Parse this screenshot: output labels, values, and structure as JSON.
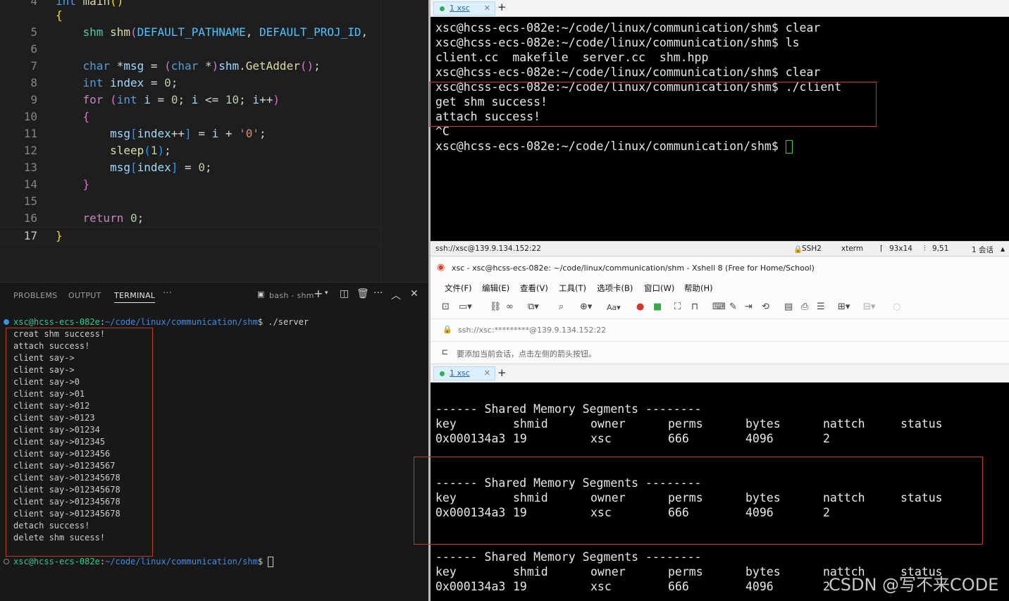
{
  "editor": {
    "lines": [
      {
        "num": "4",
        "parts": [
          [
            "k",
            "int"
          ],
          [
            "p",
            " "
          ],
          [
            "f",
            "main"
          ],
          [
            "b",
            "()"
          ]
        ]
      },
      {
        "num": "5",
        "parts": [
          [
            "b",
            "{"
          ]
        ]
      },
      {
        "num": "5",
        "parts": [
          [
            "p",
            "    "
          ],
          [
            "t",
            "shm"
          ],
          [
            "p",
            " "
          ],
          [
            "f",
            "shm"
          ],
          [
            "b2",
            "("
          ],
          [
            "c",
            "DEFAULT_PATHNAME"
          ],
          [
            "p",
            ", "
          ],
          [
            "c",
            "DEFAULT_PROJ_ID"
          ],
          [
            "p",
            ","
          ]
        ]
      },
      {
        "num": "6",
        "parts": []
      },
      {
        "num": "7",
        "parts": [
          [
            "p",
            "    "
          ],
          [
            "k",
            "char"
          ],
          [
            "p",
            " *"
          ],
          [
            "v",
            "msg"
          ],
          [
            "p",
            " = "
          ],
          [
            "b2",
            "("
          ],
          [
            "k",
            "char"
          ],
          [
            "p",
            " *"
          ],
          [
            "b2",
            ")"
          ],
          [
            "v",
            "shm"
          ],
          [
            "p",
            "."
          ],
          [
            "f",
            "GetAdder"
          ],
          [
            "b2",
            "()"
          ],
          [
            "p",
            ";"
          ]
        ]
      },
      {
        "num": "8",
        "parts": [
          [
            "p",
            "    "
          ],
          [
            "k",
            "int"
          ],
          [
            "p",
            " "
          ],
          [
            "v",
            "index"
          ],
          [
            "p",
            " = "
          ],
          [
            "n",
            "0"
          ],
          [
            "p",
            ";"
          ]
        ]
      },
      {
        "num": "9",
        "parts": [
          [
            "p",
            "    "
          ],
          [
            "m",
            "for"
          ],
          [
            "p",
            " "
          ],
          [
            "b2",
            "("
          ],
          [
            "k",
            "int"
          ],
          [
            "p",
            " "
          ],
          [
            "v",
            "i"
          ],
          [
            "p",
            " = "
          ],
          [
            "n",
            "0"
          ],
          [
            "p",
            "; "
          ],
          [
            "v",
            "i"
          ],
          [
            "p",
            " <= "
          ],
          [
            "n",
            "10"
          ],
          [
            "p",
            "; "
          ],
          [
            "v",
            "i"
          ],
          [
            "p",
            "++"
          ],
          [
            "b2",
            ")"
          ]
        ]
      },
      {
        "num": "10",
        "parts": [
          [
            "p",
            "    "
          ],
          [
            "b2",
            "{"
          ]
        ]
      },
      {
        "num": "11",
        "parts": [
          [
            "p",
            "        "
          ],
          [
            "v",
            "msg"
          ],
          [
            "b3",
            "["
          ],
          [
            "v",
            "index"
          ],
          [
            "p",
            "++"
          ],
          [
            "b3",
            "]"
          ],
          [
            "p",
            " = "
          ],
          [
            "v",
            "i"
          ],
          [
            "p",
            " + "
          ],
          [
            "s",
            "'0'"
          ],
          [
            "p",
            ";"
          ]
        ]
      },
      {
        "num": "12",
        "parts": [
          [
            "p",
            "        "
          ],
          [
            "f",
            "sleep"
          ],
          [
            "b3",
            "("
          ],
          [
            "n",
            "1"
          ],
          [
            "b3",
            ")"
          ],
          [
            "p",
            ";"
          ]
        ]
      },
      {
        "num": "13",
        "parts": [
          [
            "p",
            "        "
          ],
          [
            "v",
            "msg"
          ],
          [
            "b3",
            "["
          ],
          [
            "v",
            "index"
          ],
          [
            "b3",
            "]"
          ],
          [
            "p",
            " = "
          ],
          [
            "n",
            "0"
          ],
          [
            "p",
            ";"
          ]
        ]
      },
      {
        "num": "14",
        "parts": [
          [
            "p",
            "    "
          ],
          [
            "b2",
            "}"
          ]
        ]
      },
      {
        "num": "15",
        "parts": []
      },
      {
        "num": "16",
        "parts": [
          [
            "p",
            "    "
          ],
          [
            "m",
            "return"
          ],
          [
            "p",
            " "
          ],
          [
            "n",
            "0"
          ],
          [
            "p",
            ";"
          ]
        ]
      },
      {
        "num": "17",
        "parts": [
          [
            "b",
            "}"
          ]
        ]
      }
    ]
  },
  "panel": {
    "tabs": [
      "PROBLEMS",
      "OUTPUT",
      "TERMINAL"
    ],
    "more": "···",
    "terminal_name": "bash - shm",
    "prompt_user": "xsc@hcss-ecs-082e",
    "prompt_path": "~/code/linux/communication/shm",
    "command": "./server",
    "output": [
      "creat shm success!",
      "attach success!",
      "client say->",
      "client say->",
      "client say->0",
      "client say->01",
      "client say->012",
      "client say->0123",
      "client say->01234",
      "client say->012345",
      "client say->0123456",
      "client say->01234567",
      "client say->012345678",
      "client say->012345678",
      "client say->012345678",
      "client say->012345678",
      "detach success!",
      "delete shm sucess!"
    ]
  },
  "xshell_top": {
    "tab_label": "1 xsc",
    "lines": [
      "xsc@hcss-ecs-082e:~/code/linux/communication/shm$ clear",
      "xsc@hcss-ecs-082e:~/code/linux/communication/shm$ ls",
      "client.cc  makefile  server.cc  shm.hpp",
      "xsc@hcss-ecs-082e:~/code/linux/communication/shm$ clear",
      "xsc@hcss-ecs-082e:~/code/linux/communication/shm$ ./client",
      "get shm success!",
      "attach success!",
      "^C",
      "xsc@hcss-ecs-082e:~/code/linux/communication/shm$ "
    ]
  },
  "status_bar": {
    "ssh": "ssh://xsc@139.9.134.152:22",
    "protocol": "SSH2",
    "term": "xterm",
    "size": "93x14",
    "pos": "9,51",
    "sessions": "1 会话"
  },
  "xshell_window": {
    "title": "xsc - xsc@hcss-ecs-082e: ~/code/linux/communication/shm - Xshell 8 (Free for Home/School)",
    "menu": [
      "文件(F)",
      "编辑(E)",
      "查看(V)",
      "工具(T)",
      "选项卡(B)",
      "窗口(W)",
      "帮助(H)"
    ],
    "address": "ssh://xsc:*********@139.9.134.152:22",
    "hint": "要添加当前会话，点击左侧的箭头按钮。",
    "tab_label": "1 xsc"
  },
  "xshell_bottom": {
    "header": "------ Shared Memory Segments --------",
    "columns": [
      "key",
      "shmid",
      "owner",
      "perms",
      "bytes",
      "nattch",
      "status"
    ],
    "rows": [
      [
        "0x000134a3",
        "19",
        "xsc",
        "666",
        "4096",
        "2",
        ""
      ],
      [
        "0x000134a3",
        "19",
        "xsc",
        "666",
        "4096",
        "2",
        ""
      ],
      [
        "0x000134a3",
        "19",
        "xsc",
        "666",
        "4096",
        "2",
        ""
      ]
    ]
  },
  "watermark": "CSDN @写不来CODE"
}
